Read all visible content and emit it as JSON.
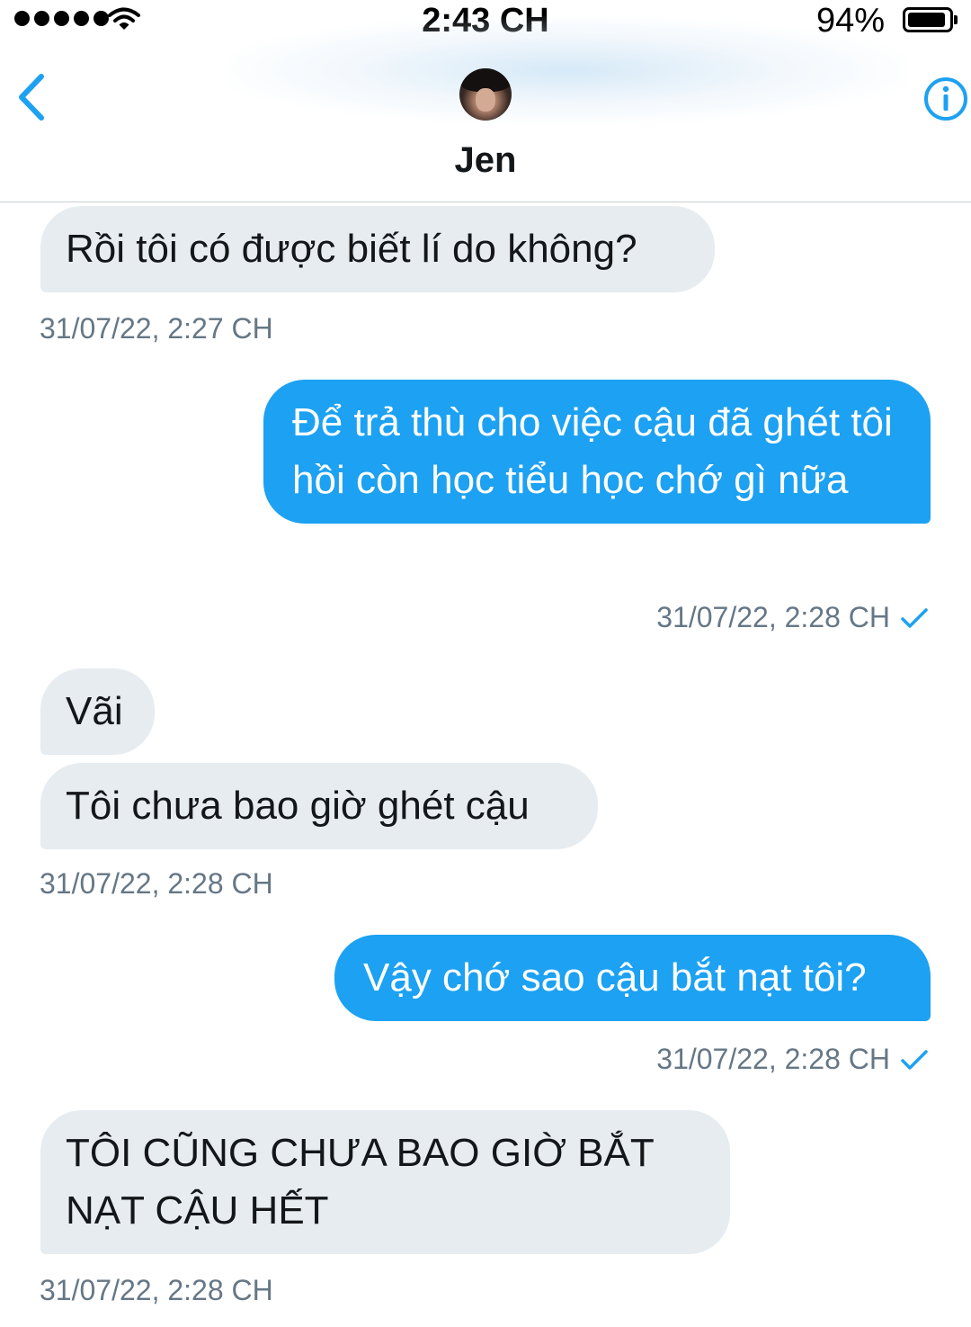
{
  "status_bar": {
    "time": "2:43 CH",
    "battery_percent": "94%",
    "battery_level": 0.94,
    "signal_bars": 5
  },
  "header": {
    "contact_name": "Jen",
    "back_icon": "chevron-left-icon",
    "info_icon": "info-circle-icon",
    "accent_color": "#1da1f2"
  },
  "messages": [
    {
      "direction": "in",
      "text": "Rồi tôi có được biết lí do không?",
      "timestamp": "31/07/22, 2:27 CH"
    },
    {
      "direction": "out",
      "text": "Để trả thù cho việc cậu đã ghét tôi hồi còn học tiểu học chớ gì nữa",
      "timestamp": "31/07/22, 2:28 CH",
      "read": true
    },
    {
      "direction": "in",
      "text": "Vãi"
    },
    {
      "direction": "in",
      "text": "Tôi chưa bao giờ ghét cậu",
      "timestamp": "31/07/22, 2:28 CH"
    },
    {
      "direction": "out",
      "text": "Vậy chớ sao cậu bắt nạt tôi?",
      "timestamp": "31/07/22, 2:28 CH",
      "read": true
    },
    {
      "direction": "in",
      "text": "TÔI CŨNG CHƯA BAO GIỜ BẮT NẠT CẬU HẾT",
      "timestamp": "31/07/22, 2:28 CH"
    }
  ],
  "colors": {
    "incoming_bubble": "#e6ecf0",
    "outgoing_bubble": "#1da1f2",
    "timestamp": "#657786"
  }
}
